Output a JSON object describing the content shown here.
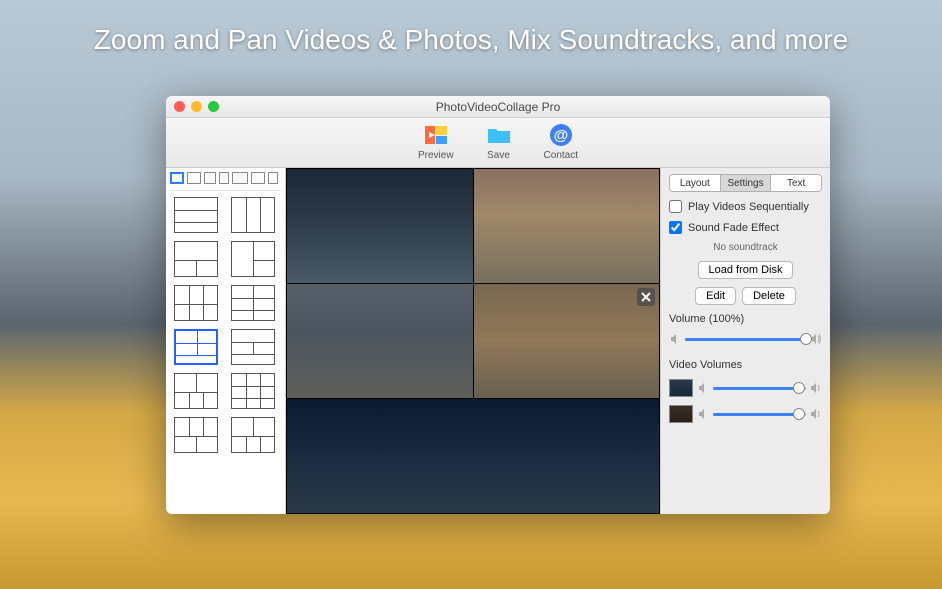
{
  "banner": "Zoom and Pan Videos & Photos, Mix Soundtracks, and more",
  "window": {
    "title": "PhotoVideoCollage Pro"
  },
  "toolbar": {
    "preview_label": "Preview",
    "save_label": "Save",
    "contact_label": "Contact"
  },
  "tabs": {
    "layout": "Layout",
    "settings": "Settings",
    "text": "Text",
    "active": "settings"
  },
  "settings": {
    "play_sequentially": "Play Videos Sequentially",
    "play_sequentially_checked": false,
    "sound_fade": "Sound Fade Effect",
    "sound_fade_checked": true,
    "no_soundtrack": "No soundtrack",
    "load_from_disk": "Load from Disk",
    "edit": "Edit",
    "delete": "Delete",
    "volume_label": "Volume  (100%)",
    "volume_pct": 100,
    "video_volumes_label": "Video Volumes",
    "video_volumes": [
      {
        "pct": 92
      },
      {
        "pct": 92
      }
    ]
  },
  "left_panel": {
    "aspect_ratios": [
      {
        "w": 14,
        "selected": true
      },
      {
        "w": 14,
        "selected": false
      },
      {
        "w": 12,
        "selected": false
      },
      {
        "w": 10,
        "selected": false
      },
      {
        "w": 16,
        "selected": false
      },
      {
        "w": 14,
        "selected": false
      },
      {
        "w": 10,
        "selected": false
      }
    ],
    "selected_layout_index": 6
  },
  "colors": {
    "accent": "#2a7fff"
  }
}
